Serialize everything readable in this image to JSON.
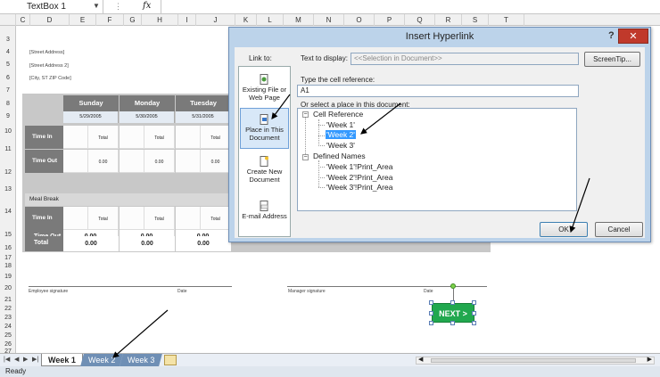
{
  "formula_bar": {
    "name_box": "TextBox 1",
    "fx": "fx"
  },
  "columns": [
    "D",
    "E",
    "F",
    "G",
    "H",
    "I",
    "J",
    "K",
    "L",
    "M",
    "N",
    "O",
    "P",
    "Q",
    "R",
    "S",
    "T"
  ],
  "rows": [
    "3",
    "4",
    "5",
    "6",
    "7",
    "8",
    "9",
    "10",
    "11",
    "12",
    "13",
    "14",
    "15",
    "16",
    "17",
    "18",
    "19",
    "20",
    "21",
    "22",
    "23",
    "24",
    "25",
    "26",
    "27"
  ],
  "sheet": {
    "addresses": [
      "[Street Address]",
      "[Street Address 2]",
      "[City, ST  ZIP Code]"
    ],
    "days": [
      {
        "name": "Sunday",
        "date": "5/29/2005"
      },
      {
        "name": "Monday",
        "date": "5/30/2005"
      },
      {
        "name": "Tuesday",
        "date": "5/31/2005"
      }
    ],
    "row_labels": {
      "time_in": "Time In",
      "time_out": "Time Out",
      "meal_break": "Meal Break",
      "total": "Total"
    },
    "cell_total": "Total",
    "zero": "0.00",
    "signatures": {
      "employee": "Employee signature",
      "manager": "Manager signature",
      "date": "Date"
    },
    "next_button": "NEXT >"
  },
  "tabs": [
    {
      "label": "Week 1",
      "active": true
    },
    {
      "label": "Week 2",
      "active": false
    },
    {
      "label": "Week 3",
      "active": false
    }
  ],
  "status": "Ready",
  "dialog": {
    "title": "Insert Hyperlink",
    "help": "?",
    "close": "✕",
    "link_to": "Link to:",
    "link_items": [
      {
        "label": "Existing File or Web Page"
      },
      {
        "label": "Place in This Document",
        "selected": true
      },
      {
        "label": "Create New Document"
      },
      {
        "label": "E-mail Address"
      }
    ],
    "text_to_display_label": "Text to display:",
    "text_to_display_value": "<<Selection in Document>>",
    "screentip": "ScreenTip...",
    "cell_ref_label": "Type the cell reference:",
    "cell_ref_value": "A1",
    "place_label": "Or select a place in this document:",
    "tree": {
      "cell_reference": "Cell Reference",
      "sheets": [
        "'Week 1'",
        "'Week 2'",
        "'Week 3'"
      ],
      "selected_index": 1,
      "defined_names": "Defined Names",
      "names": [
        "'Week 1'!Print_Area",
        "'Week 2'!Print_Area",
        "'Week 3'!Print_Area"
      ]
    },
    "ok": "OK",
    "cancel": "Cancel"
  },
  "colors": {
    "dialog_frame": "#bcd3ea",
    "selection": "#3399ff",
    "close": "#c0392b",
    "next": "#21a84e",
    "tab_inactive": "#6f8fb5"
  }
}
